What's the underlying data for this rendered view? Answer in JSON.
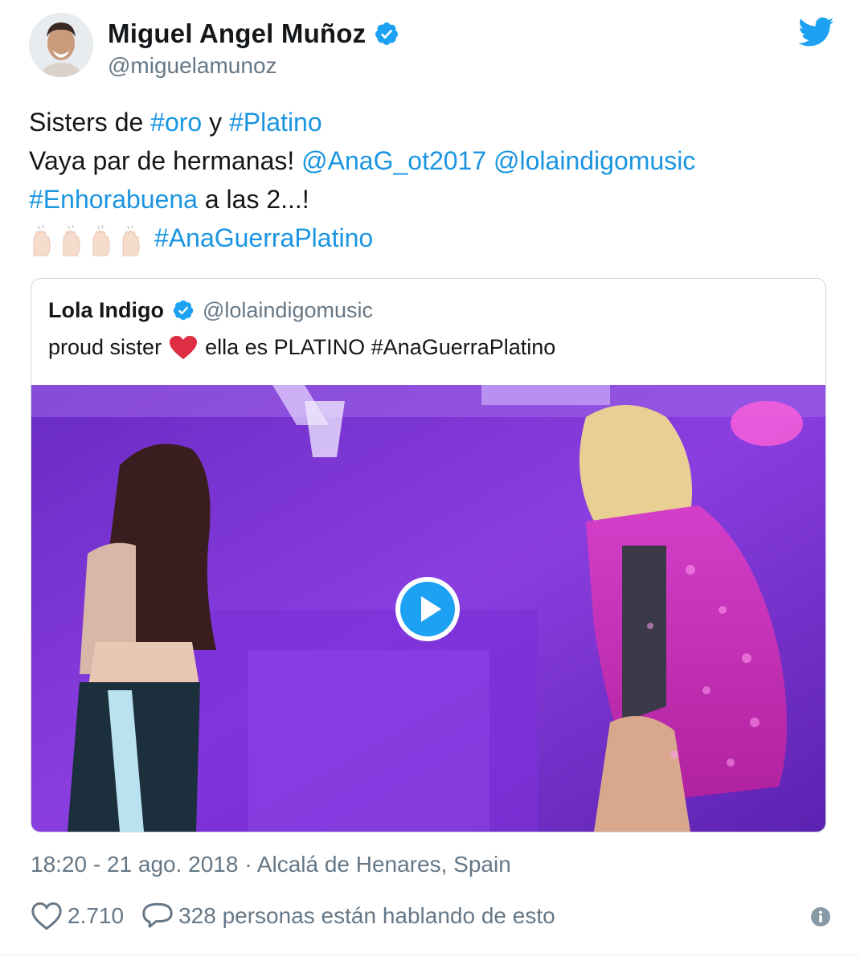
{
  "author": {
    "display_name": "Miguel Angel Muñoz",
    "handle": "@miguelamunoz",
    "verified": true
  },
  "tweet": {
    "lines": [
      [
        {
          "text": "Sisters de ",
          "type": "text"
        },
        {
          "text": "#oro",
          "type": "hashtag"
        },
        {
          "text": " y ",
          "type": "text"
        },
        {
          "text": "#Platino",
          "type": "hashtag"
        }
      ],
      [
        {
          "text": "Vaya par de hermanas! ",
          "type": "text"
        },
        {
          "text": "@AnaG_ot2017",
          "type": "mention"
        },
        {
          "text": " ",
          "type": "text"
        },
        {
          "text": "@lolaindigomusic",
          "type": "mention"
        }
      ],
      [
        {
          "text": "#Enhorabuena",
          "type": "hashtag"
        },
        {
          "text": " a las 2...!",
          "type": "text"
        }
      ],
      [
        {
          "text": "#AnaGuerraPlatino",
          "type": "hashtag"
        }
      ]
    ]
  },
  "quoted_tweet": {
    "display_name": "Lola Indigo",
    "handle": "@lolaindigomusic",
    "text_before": "proud sister",
    "text_after": "ella es PLATINO #AnaGuerraPlatino",
    "media": {
      "type": "video",
      "play_icon": "play-icon"
    }
  },
  "meta": {
    "time": "18:20 - 21 ago. 2018",
    "separator": "·",
    "location": "Alcalá de Henares, Spain"
  },
  "actions": {
    "likes": "2.710",
    "conversation": "328 personas están hablando de esto"
  },
  "colors": {
    "link": "#1b95e0",
    "muted": "#657786",
    "verified": "#1da1f2",
    "media_purple": "#7b2fd6"
  },
  "icons": [
    "verified-icon",
    "twitter-bird-icon",
    "raised-hands-icon",
    "heart-emoji-icon",
    "play-icon",
    "like-heart-icon",
    "reply-bubble-icon",
    "info-icon"
  ]
}
